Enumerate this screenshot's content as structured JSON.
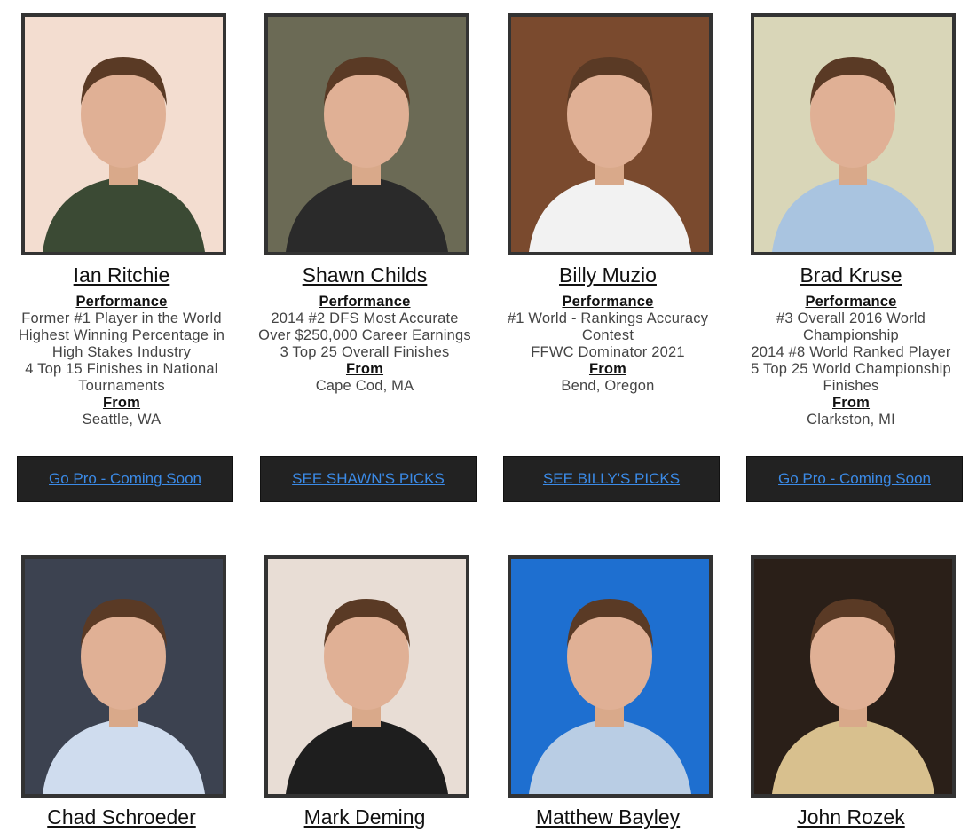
{
  "experts_row1": [
    {
      "name": "Ian Ritchie",
      "performance_label": "Performance",
      "performance": [
        "Former #1 Player in the World",
        "Highest Winning Percentage in High Stakes Industry",
        "4 Top 15 Finishes in National Tournaments"
      ],
      "from_label": "From",
      "from": "Seattle, WA",
      "button": "Go Pro - Coming Soon",
      "photo_bg": "#f3ddd0",
      "shirt": "#3b4a34"
    },
    {
      "name": "Shawn Childs",
      "performance_label": "Performance",
      "performance": [
        "2014 #2 DFS Most Accurate",
        "Over $250,000 Career Earnings",
        "3 Top 25 Overall Finishes"
      ],
      "from_label": "From",
      "from": "Cape Cod, MA",
      "button": "SEE SHAWN'S PICKS",
      "photo_bg": "#6b6a55",
      "shirt": "#2a2a2a"
    },
    {
      "name": "Billy Muzio",
      "performance_label": "Performance",
      "performance": [
        "#1 World - Rankings Accuracy Contest",
        "FFWC Dominator 2021"
      ],
      "from_label": "From",
      "from": "Bend, Oregon",
      "button": "SEE BILLY'S PICKS",
      "photo_bg": "#7a4a2e",
      "shirt": "#f2f2f2"
    },
    {
      "name": "Brad Kruse",
      "performance_label": "Performance",
      "performance": [
        "#3 Overall 2016 World Championship",
        "2014 #8 World Ranked Player",
        "5 Top 25 World Championship Finishes"
      ],
      "from_label": "From",
      "from": "Clarkston, MI",
      "button": "Go Pro - Coming Soon",
      "photo_bg": "#d9d6b8",
      "shirt": "#a9c4e0"
    }
  ],
  "experts_row2": [
    {
      "name": "Chad Schroeder",
      "photo_bg": "#3c4250",
      "shirt": "#cfdcee"
    },
    {
      "name": "Mark Deming",
      "photo_bg": "#e8ddd5",
      "shirt": "#1e1e1e"
    },
    {
      "name": "Matthew Bayley",
      "photo_bg": "#1e6fd0",
      "shirt": "#b9cde4"
    },
    {
      "name": "John Rozek",
      "photo_bg": "#2a1f18",
      "shirt": "#d8c08e"
    }
  ],
  "colors": {
    "button_bg": "#222222",
    "link": "#3b8ae6",
    "frame": "#333333"
  }
}
